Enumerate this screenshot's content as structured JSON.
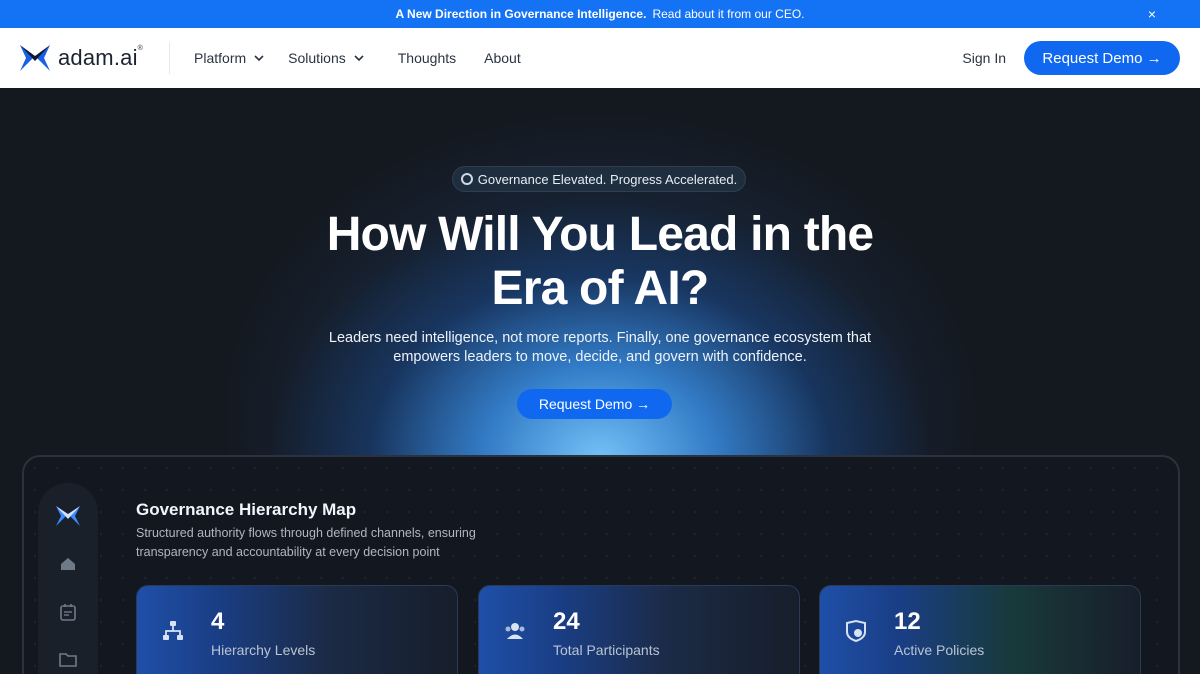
{
  "announcement": {
    "bold": "A New Direction in Governance Intelligence.",
    "text": "Read about it from our CEO.",
    "close": "×"
  },
  "nav": {
    "logo_text": "adam.ai",
    "logo_mark": "®",
    "items": [
      "Platform",
      "Solutions",
      "Thoughts",
      "About"
    ],
    "sign_in": "Sign In",
    "cta": "Request Demo →"
  },
  "hero": {
    "badge": "Governance Elevated. Progress Accelerated.",
    "headline_line1": "How Will You Lead in the",
    "headline_line2": "Era of AI?",
    "sub_line1": "Leaders need intelligence, not more reports. Finally, one governance ecosystem that",
    "sub_line2": "empowers leaders to move, decide, and govern with confidence.",
    "cta": "Request Demo →"
  },
  "dashboard": {
    "title": "Governance Hierarchy Map",
    "desc_line1": "Structured authority flows through defined channels, ensuring",
    "desc_line2": "transparency and accountability at every decision point",
    "sidebar_icons": [
      "logo-icon",
      "home-icon",
      "calendar-icon",
      "folder-icon"
    ],
    "stats": [
      {
        "value": "4",
        "label": "Hierarchy Levels",
        "icon": "hierarchy-icon"
      },
      {
        "value": "24",
        "label": "Total Participants",
        "icon": "users-icon"
      },
      {
        "value": "12",
        "label": "Active Policies",
        "icon": "shield-icon"
      }
    ]
  },
  "colors": {
    "accent": "#1068f0",
    "announcement_bg": "#1472f5",
    "page_bg": "#14181f"
  }
}
